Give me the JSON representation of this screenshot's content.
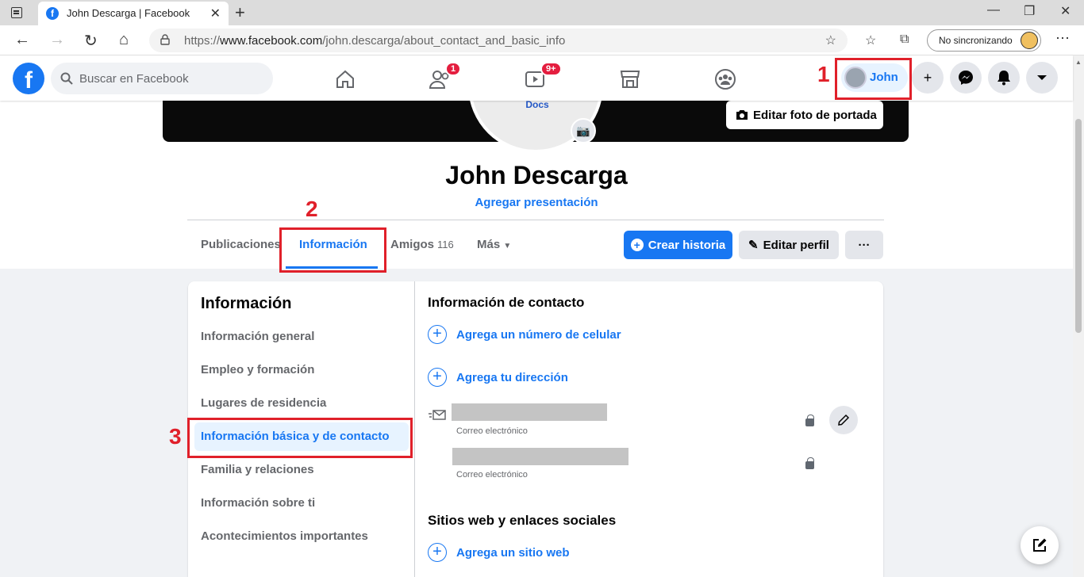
{
  "browser": {
    "tab_title": "John Descarga | Facebook",
    "url_prefix": "https://",
    "url_domain": "www.facebook.com",
    "url_path": "/john.descarga/about_contact_and_basic_info",
    "sync_label": "No sincronizando"
  },
  "fbnav": {
    "search_placeholder": "Buscar en Facebook",
    "friends_badge": "1",
    "watch_badge": "9+",
    "profile_name": "John"
  },
  "profile": {
    "avatar_text": "Google Docs",
    "edit_cover_label": "Editar foto de portada",
    "name": "John Descarga",
    "bio_link": "Agregar presentación",
    "tabs": [
      {
        "label": "Publicaciones"
      },
      {
        "label": "Información"
      },
      {
        "label": "Amigos",
        "count": "116"
      },
      {
        "label": "Más"
      }
    ],
    "create_story_label": "Crear historia",
    "edit_profile_label": "Editar perfil"
  },
  "annotations": {
    "one": "1",
    "two": "2",
    "three": "3"
  },
  "about": {
    "title": "Información",
    "menu": [
      "Información general",
      "Empleo y formación",
      "Lugares de residencia",
      "Información básica y de contacto",
      "Familia y relaciones",
      "Información sobre ti",
      "Acontecimientos importantes"
    ],
    "contact_title": "Información de contacto",
    "add_phone": "Agrega un número de celular",
    "add_address": "Agrega tu dirección",
    "email_sublabel_1": "Correo electrónico",
    "email_sublabel_2": "Correo electrónico",
    "websites_title": "Sitios web y enlaces sociales",
    "add_website": "Agrega un sitio web"
  },
  "colors": {
    "fb_blue": "#1877f2",
    "annotation_red": "#e0202a"
  }
}
